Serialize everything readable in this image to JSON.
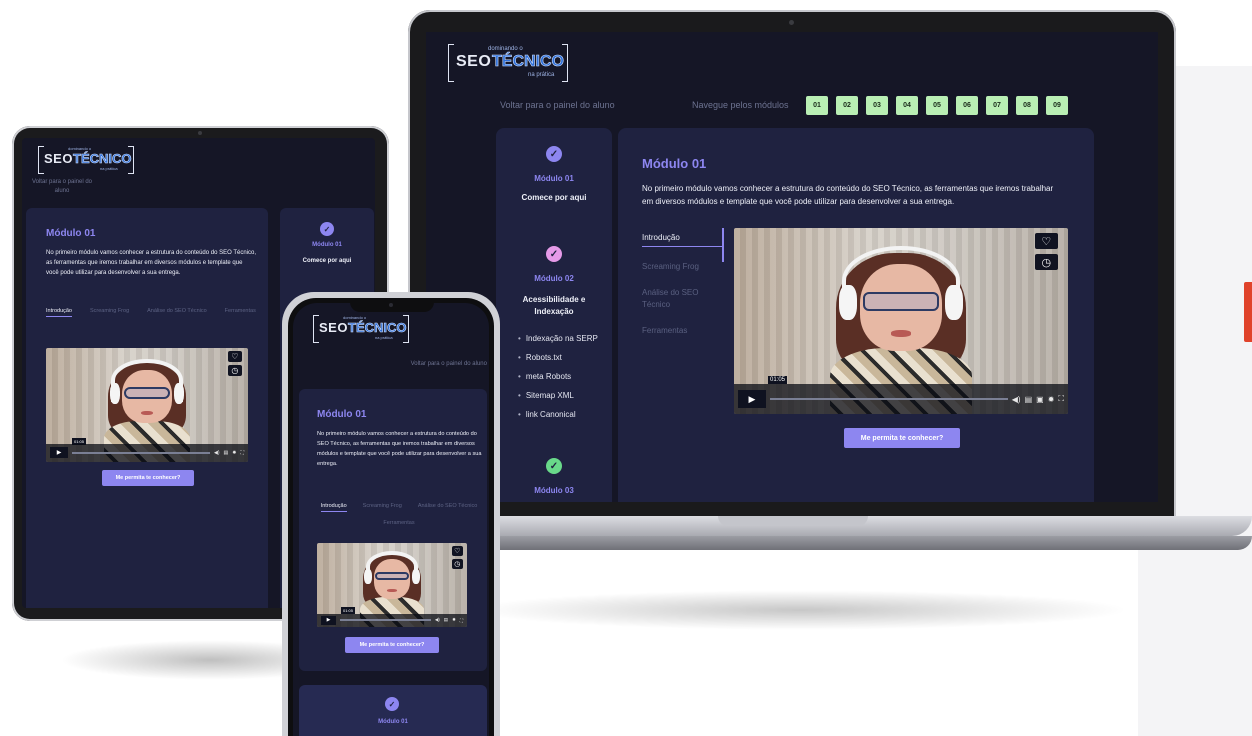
{
  "brand": {
    "logo_top": "dominando o",
    "logo_seo": "SEO",
    "logo_tecnico": "TÉCNICO",
    "logo_bottom": "na prática"
  },
  "nav": {
    "back_label": "Voltar para o painel do aluno",
    "modules_label": "Navegue pelos módulos",
    "modules": [
      "01",
      "02",
      "03",
      "04",
      "05",
      "06",
      "07",
      "08",
      "09"
    ]
  },
  "sidebar": {
    "module1": {
      "title": "Módulo 01",
      "subtitle": "Comece por aqui"
    },
    "module2": {
      "title": "Módulo 02",
      "subtitle": "Acessibilidade e Indexação",
      "topics": [
        "Indexação na SERP",
        "Robots.txt",
        "meta Robots",
        "Sitemap XML",
        "link Canonical"
      ]
    },
    "module3": {
      "title": "Módulo 03"
    }
  },
  "main": {
    "title": "Módulo 01",
    "description": "No primeiro módulo vamos conhecer a estrutura do conteúdo do SEO Técnico, as ferramentas que iremos trabalhar em diversos módulos e template que você pode utilizar para desenvolver a sua entrega.",
    "tabs": [
      "Introdução",
      "Screaming Frog",
      "Análise do SEO Técnico",
      "Ferramentas"
    ],
    "video_time": "01:05",
    "cta": "Me permita te conhecer?"
  },
  "colors": {
    "accent": "#8d86f0",
    "module_chip": "#b9efb4",
    "check_module1": "#8d86f0",
    "check_module2": "#e59ae8",
    "check_module3": "#69d98a"
  },
  "icons": {
    "check": "✓",
    "play": "▶",
    "heart": "♡",
    "clock": "◷"
  }
}
